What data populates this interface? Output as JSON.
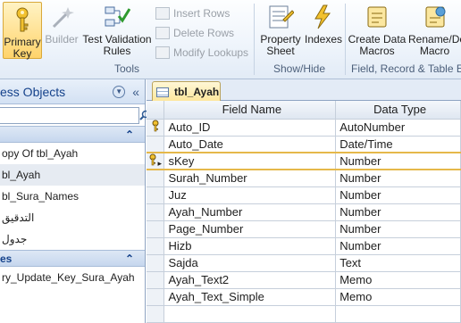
{
  "ribbon": {
    "tools": {
      "primary_key": "Primary\nKey",
      "builder": "Builder",
      "test_validation": "Test Validation\nRules",
      "insert_rows": "Insert Rows",
      "delete_rows": "Delete Rows",
      "modify_lookups": "Modify Lookups",
      "group_label": "Tools"
    },
    "show_hide": {
      "property_sheet": "Property\nSheet",
      "indexes": "Indexes",
      "group_label": "Show/Hide"
    },
    "field_events": {
      "create_macros": "Create Data\nMacros",
      "rename_macro": "Rename/De\nMacro",
      "group_label": "Field, Record & Table Ev"
    }
  },
  "nav": {
    "title": "ess Objects",
    "search_value": "",
    "sections": [
      {
        "label": "",
        "items": [
          "opy Of tbl_Ayah",
          "bl_Ayah",
          "bl_Sura_Names",
          "التدقيق",
          "جدول"
        ]
      },
      {
        "label": "es",
        "items": [
          "ry_Update_Key_Sura_Ayah"
        ]
      }
    ]
  },
  "document": {
    "tab_label": "tbl_Ayah",
    "columns": [
      "Field Name",
      "Data Type"
    ],
    "rows": [
      {
        "field": "Auto_ID",
        "type": "AutoNumber",
        "key": true
      },
      {
        "field": "Auto_Date",
        "type": "Date/Time",
        "key": false
      },
      {
        "field": "sKey",
        "type": "Number",
        "key": true
      },
      {
        "field": "Surah_Number",
        "type": "Number",
        "key": false
      },
      {
        "field": "Juz",
        "type": "Number",
        "key": false
      },
      {
        "field": "Ayah_Number",
        "type": "Number",
        "key": false
      },
      {
        "field": "Page_Number",
        "type": "Number",
        "key": false
      },
      {
        "field": "Hizb",
        "type": "Number",
        "key": false
      },
      {
        "field": "Sajda",
        "type": "Text",
        "key": false
      },
      {
        "field": "Ayah_Text2",
        "type": "Memo",
        "key": false
      },
      {
        "field": "Ayah_Text_Simple",
        "type": "Memo",
        "key": false
      },
      {
        "field": "",
        "type": "",
        "key": false
      }
    ]
  },
  "colors": {
    "accent_selected": "#ffd36b",
    "ribbon_bg": "#eef4fb",
    "active_row_border": "#e5b84a"
  }
}
